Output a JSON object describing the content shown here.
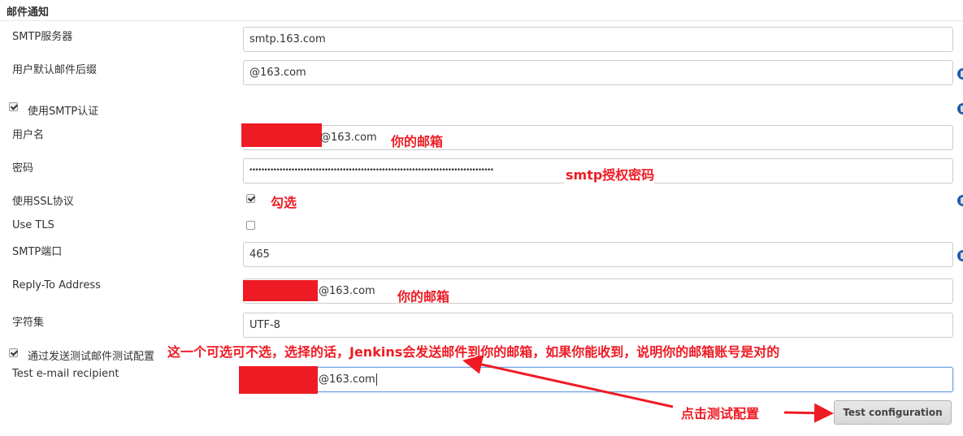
{
  "section": {
    "title": "邮件通知"
  },
  "fields": {
    "smtp_server": {
      "label": "SMTP服务器",
      "value": "smtp.163.com"
    },
    "default_suffix": {
      "label": "用户默认邮件后缀",
      "value": "@163.com"
    },
    "use_smtp_auth": {
      "label": "使用SMTP认证",
      "checked": true
    },
    "username": {
      "label": "用户名",
      "value_suffix": "@163.com"
    },
    "password": {
      "label": "密码",
      "value": "•••••••••••••••••••••••••••••••••••••••••••••••••••••••••••••••••••••••••••••••••"
    },
    "use_ssl": {
      "label": "使用SSL协议",
      "checked": true
    },
    "use_tls": {
      "label": "Use TLS",
      "checked": false
    },
    "smtp_port": {
      "label": "SMTP端口",
      "value": "465"
    },
    "reply_to": {
      "label": "Reply-To Address",
      "value_suffix": "@163.com"
    },
    "charset": {
      "label": "字符集",
      "value": "UTF-8"
    },
    "test_by_sending": {
      "label": "通过发送测试邮件测试配置",
      "checked": true
    },
    "test_recipient": {
      "label": "Test e-mail recipient",
      "value_suffix": "@163.com"
    }
  },
  "buttons": {
    "test_configuration": "Test configuration"
  },
  "annotations": {
    "username_note": "你的邮箱",
    "password_note": "smtp授权密码",
    "ssl_note": "勾选",
    "reply_to_note": "你的邮箱",
    "test_note": "这一个可选可不选，选择的话，Jenkins会发送邮件到你的邮箱，如果你能收到，说明你的邮箱账号是对的",
    "click_note": "点击测试配置"
  },
  "colors": {
    "annotation": "#ee1b24",
    "help_icon": "#1f5ea8"
  },
  "icons": {
    "help": "help-icon",
    "checkbox": "checkbox"
  }
}
